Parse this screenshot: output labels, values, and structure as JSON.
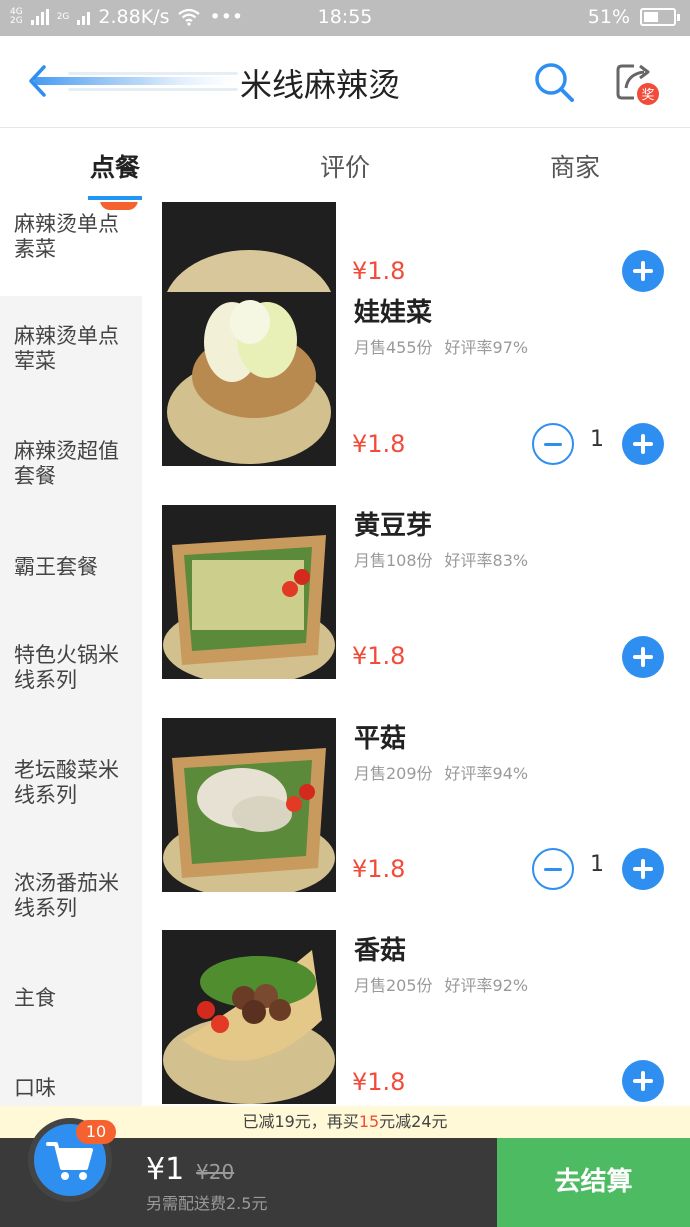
{
  "status_bar": {
    "network_top": "4G",
    "network_bottom": "2G",
    "network2": "2G",
    "speed": "2.88K/s",
    "time": "18:55",
    "battery": "51%",
    "battery_level": 0.51
  },
  "header": {
    "title": "米线麻辣烫"
  },
  "tabs": [
    {
      "label": "点餐",
      "active": true
    },
    {
      "label": "评价",
      "active": false
    },
    {
      "label": "商家",
      "active": false
    }
  ],
  "categories": [
    {
      "label": "麻辣烫单点素菜",
      "active": true
    },
    {
      "label": "麻辣烫单点荤菜",
      "active": false
    },
    {
      "label": "麻辣烫超值套餐",
      "active": false
    },
    {
      "label": "霸王套餐",
      "active": false
    },
    {
      "label": "特色火锅米线系列",
      "active": false
    },
    {
      "label": "老坛酸菜米线系列",
      "active": false
    },
    {
      "label": "浓汤番茄米线系列",
      "active": false
    },
    {
      "label": "主食",
      "active": false
    },
    {
      "label": "口味",
      "active": false
    }
  ],
  "items": [
    {
      "name": "",
      "sales": "",
      "rating": "",
      "price": "¥1.8",
      "quantity": null
    },
    {
      "name": "娃娃菜",
      "sales": "月售455份",
      "rating": "好评率97%",
      "price": "¥1.8",
      "quantity": "1"
    },
    {
      "name": "黄豆芽",
      "sales": "月售108份",
      "rating": "好评率83%",
      "price": "¥1.8",
      "quantity": null
    },
    {
      "name": "平菇",
      "sales": "月售209份",
      "rating": "好评率94%",
      "price": "¥1.8",
      "quantity": "1"
    },
    {
      "name": "香菇",
      "sales": "月售205份",
      "rating": "好评率92%",
      "price": "¥1.8",
      "quantity": null
    }
  ],
  "promo": {
    "prefix": "已减19元，再买",
    "amount": "15",
    "suffix": "元减24元"
  },
  "cart": {
    "count": "10",
    "total": "¥1",
    "original": "¥20",
    "delivery": "另需配送费2.5元",
    "checkout_label": "去结算"
  },
  "colors": {
    "accent": "#2f8ff0",
    "price": "#f24b3a",
    "checkout": "#4dbb62",
    "badge": "#f5612f"
  }
}
